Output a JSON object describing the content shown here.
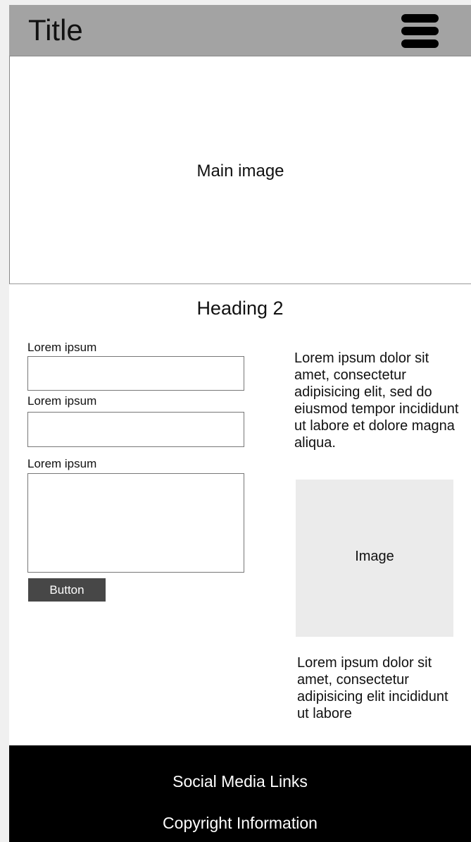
{
  "header": {
    "title": "Title",
    "menu_icon": "hamburger-menu-icon"
  },
  "hero": {
    "label": "Main image"
  },
  "content": {
    "heading": "Heading 2",
    "form": {
      "field1_label": "Lorem ipsum",
      "field2_label": "Lorem ipsum",
      "field3_label": "Lorem ipsum",
      "field1_value": "",
      "field2_value": "",
      "field3_value": "",
      "button_label": "Button"
    },
    "side": {
      "paragraph1": "Lorem ipsum dolor sit amet, consectetur adipisicing elit, sed do eiusmod tempor incididunt ut labore et dolore magna aliqua.",
      "image_label": "Image",
      "paragraph2": "Lorem ipsum dolor sit amet, consectetur adipisicing elit incididunt ut labore"
    }
  },
  "footer": {
    "social": "Social Media Links",
    "copyright": "Copyright Information"
  }
}
